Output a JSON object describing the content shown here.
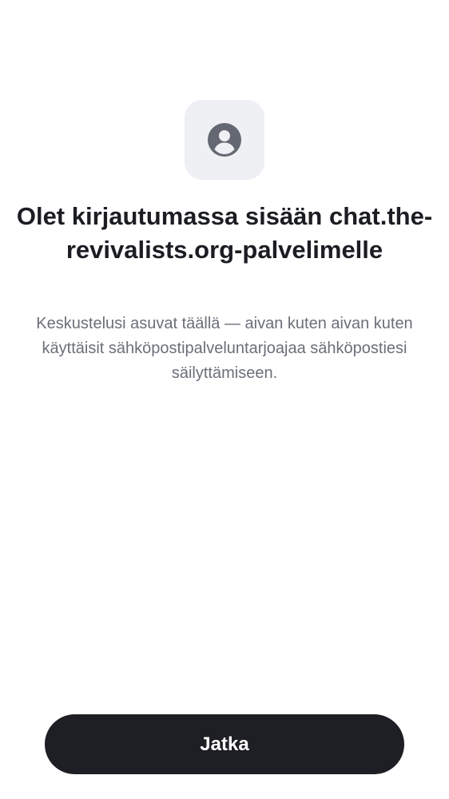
{
  "header": {
    "icon": "user-avatar-icon",
    "title": "Olet kirjautumassa sisään chat.the-revivalists.org-palvelimelle",
    "subtitle": "Keskustelusi asuvat täällä — aivan kuten aivan kuten käyttäisit sähköpostipalveluntarjoajaa sähköpostiesi säilyttämiseen."
  },
  "actions": {
    "continue_label": "Jatka"
  },
  "colors": {
    "icon_tile_bg": "#eff0f4",
    "icon_fg": "#646872",
    "title": "#1b1d22",
    "subtitle": "#6b6f78",
    "button_bg": "#1e1f24",
    "button_text": "#ffffff"
  }
}
